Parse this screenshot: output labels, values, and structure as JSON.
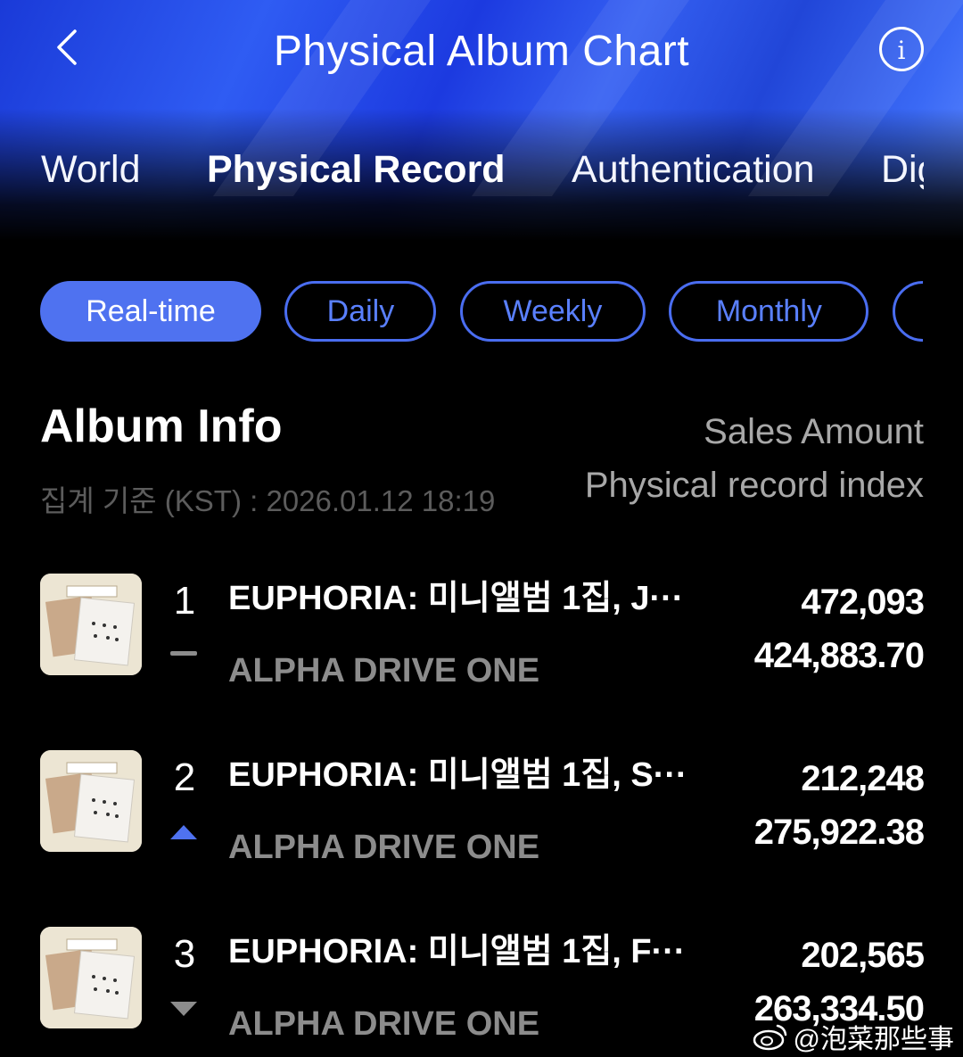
{
  "header": {
    "title": "Physical Album Chart",
    "tabs": [
      {
        "label": "World",
        "active": false
      },
      {
        "label": "Physical Record",
        "active": true
      },
      {
        "label": "Authentication",
        "active": false
      },
      {
        "label": "Digita",
        "active": false
      }
    ]
  },
  "periods": [
    {
      "label": "Real-time",
      "active": true
    },
    {
      "label": "Daily",
      "active": false
    },
    {
      "label": "Weekly",
      "active": false
    },
    {
      "label": "Monthly",
      "active": false
    },
    {
      "label": "",
      "active": false
    }
  ],
  "list": {
    "heading": "Album Info",
    "timestamp": "집계 기준 (KST) : 2026.01.12 18:19",
    "col_sales": "Sales Amount",
    "col_index": "Physical record index"
  },
  "rows": [
    {
      "rank": "1",
      "change": "same",
      "title": "EUPHORIA: 미니앨범 1집, J···",
      "artist": "ALPHA DRIVE ONE",
      "sales": "472,093",
      "index": "424,883.70"
    },
    {
      "rank": "2",
      "change": "up",
      "title": "EUPHORIA: 미니앨범 1집, S···",
      "artist": "ALPHA DRIVE ONE",
      "sales": "212,248",
      "index": "275,922.38"
    },
    {
      "rank": "3",
      "change": "down",
      "title": "EUPHORIA: 미니앨범 1집, F···",
      "artist": "ALPHA DRIVE ONE",
      "sales": "202,565",
      "index": "263,334.50"
    }
  ],
  "watermark": "@泡菜那些事",
  "colors": {
    "accent": "#4f72f0",
    "up": "#4f72f0",
    "down": "#8c8c8c",
    "same": "#8c8c8c"
  }
}
